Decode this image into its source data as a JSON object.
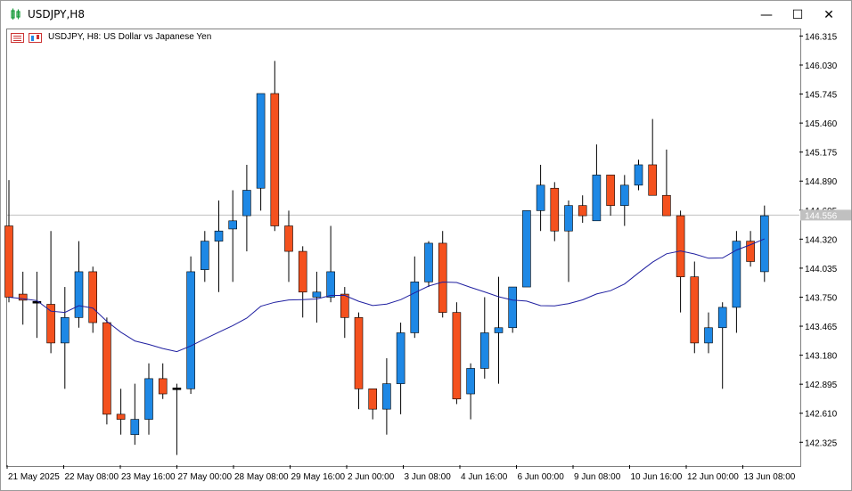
{
  "window": {
    "title": "USDJPY,H8",
    "controls": {
      "minimize": "—",
      "maximize": "☐",
      "close": "✕"
    }
  },
  "chart_header": {
    "symbol_period": "USDJPY, H8:",
    "description": "US Dollar vs Japanese Yen"
  },
  "chart_data": {
    "type": "candlestick",
    "symbol": "USDJPY",
    "timeframe": "H8",
    "bull_color": "#1e88e5",
    "bear_color": "#f4511e",
    "doji_color": "#000000",
    "ma_color": "#1f1fa0",
    "current_price_line_color": "#c0c0c0",
    "ylim": [
      142.1,
      146.38
    ],
    "y_ticks": [
      142.325,
      142.61,
      142.895,
      143.18,
      143.465,
      143.75,
      144.035,
      144.32,
      144.605,
      144.89,
      145.175,
      145.46,
      145.745,
      146.03,
      146.315
    ],
    "y_tick_labels": [
      "142.325",
      "142.610",
      "142.895",
      "143.180",
      "143.465",
      "143.750",
      "144.035",
      "144.320",
      "144.605",
      "144.890",
      "145.175",
      "145.460",
      "145.745",
      "146.030",
      "146.315"
    ],
    "current_price": 144.556,
    "current_price_label": "144.556",
    "x_labels": [
      "21 May 2025",
      "22 May 08:00",
      "23 May 16:00",
      "27 May 00:00",
      "28 May 08:00",
      "29 May 16:00",
      "2 Jun 00:00",
      "3 Jun 08:00",
      "4 Jun 16:00",
      "6 Jun 00:00",
      "9 Jun 08:00",
      "10 Jun 16:00",
      "12 Jun 00:00",
      "13 Jun 08:00"
    ],
    "candles": [
      [
        144.45,
        144.9,
        143.7,
        143.75
      ],
      [
        143.78,
        144.0,
        143.48,
        143.72
      ],
      [
        143.7,
        144.0,
        143.35,
        143.68
      ],
      [
        143.68,
        144.4,
        143.2,
        143.3
      ],
      [
        143.3,
        143.85,
        142.85,
        143.55
      ],
      [
        143.55,
        144.3,
        143.45,
        144.0
      ],
      [
        144.0,
        144.05,
        143.4,
        143.5
      ],
      [
        143.5,
        143.55,
        142.5,
        142.6
      ],
      [
        142.6,
        142.85,
        142.4,
        142.55
      ],
      [
        142.4,
        142.9,
        142.3,
        142.55
      ],
      [
        142.55,
        143.1,
        142.4,
        142.95
      ],
      [
        142.95,
        143.1,
        142.75,
        142.8
      ],
      [
        142.85,
        142.9,
        142.2,
        142.85
      ],
      [
        142.85,
        144.15,
        142.8,
        144.0
      ],
      [
        144.02,
        144.4,
        143.9,
        144.3
      ],
      [
        144.3,
        144.7,
        143.8,
        144.4
      ],
      [
        144.42,
        144.8,
        143.9,
        144.5
      ],
      [
        144.55,
        145.05,
        144.2,
        144.8
      ],
      [
        144.82,
        145.4,
        144.6,
        145.75
      ],
      [
        145.75,
        146.07,
        144.4,
        144.45
      ],
      [
        144.45,
        144.6,
        143.9,
        144.2
      ],
      [
        144.2,
        144.25,
        143.55,
        143.8
      ],
      [
        143.75,
        144.0,
        143.5,
        143.8
      ],
      [
        143.75,
        144.45,
        143.7,
        144.0
      ],
      [
        143.78,
        143.85,
        143.35,
        143.55
      ],
      [
        143.55,
        143.6,
        142.65,
        142.85
      ],
      [
        142.85,
        142.85,
        142.55,
        142.65
      ],
      [
        142.65,
        143.15,
        142.4,
        142.9
      ],
      [
        142.9,
        143.5,
        142.6,
        143.4
      ],
      [
        143.4,
        144.15,
        143.35,
        143.9
      ],
      [
        143.9,
        144.3,
        143.85,
        144.28
      ],
      [
        144.28,
        144.4,
        143.55,
        143.6
      ],
      [
        143.6,
        143.7,
        142.7,
        142.75
      ],
      [
        142.8,
        143.1,
        142.55,
        143.05
      ],
      [
        143.05,
        143.75,
        142.95,
        143.4
      ],
      [
        143.4,
        143.95,
        142.9,
        143.45
      ],
      [
        143.45,
        143.85,
        143.4,
        143.85
      ],
      [
        143.85,
        144.6,
        143.85,
        144.6
      ],
      [
        144.6,
        145.05,
        144.4,
        144.85
      ],
      [
        144.82,
        144.88,
        144.3,
        144.4
      ],
      [
        144.4,
        144.7,
        143.9,
        144.65
      ],
      [
        144.65,
        144.75,
        144.48,
        144.55
      ],
      [
        144.5,
        145.25,
        144.5,
        144.95
      ],
      [
        144.95,
        144.95,
        144.55,
        144.65
      ],
      [
        144.65,
        144.95,
        144.45,
        144.85
      ],
      [
        144.85,
        145.1,
        144.8,
        145.05
      ],
      [
        145.05,
        145.5,
        144.75,
        144.75
      ],
      [
        144.75,
        145.2,
        144.6,
        144.55
      ],
      [
        144.55,
        144.6,
        143.6,
        143.95
      ],
      [
        143.95,
        144.1,
        143.2,
        143.3
      ],
      [
        143.3,
        143.6,
        143.2,
        143.45
      ],
      [
        143.45,
        143.7,
        142.85,
        143.65
      ],
      [
        143.65,
        144.4,
        143.4,
        144.3
      ],
      [
        144.3,
        144.4,
        144.05,
        144.1
      ],
      [
        144.0,
        144.65,
        143.9,
        144.55
      ]
    ],
    "ma_period": 20
  }
}
